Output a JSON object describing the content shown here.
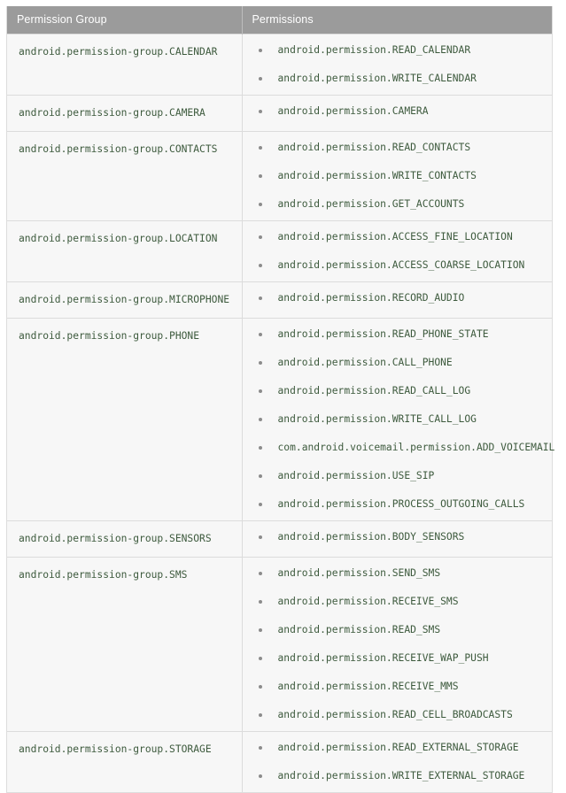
{
  "table": {
    "columns": [
      {
        "key": "group",
        "label": "Permission Group"
      },
      {
        "key": "permissions",
        "label": "Permissions"
      }
    ],
    "colors": {
      "header_bg": "#9b9b9b",
      "header_text": "#ffffff",
      "cell_bg": "#f7f7f7",
      "cell_text": "#3d5a3d",
      "border": "#dcdcdc",
      "bullet": "#8c8c8c"
    },
    "rows": [
      {
        "group": "android.permission-group.CALENDAR",
        "permissions": [
          "android.permission.READ_CALENDAR",
          "android.permission.WRITE_CALENDAR"
        ]
      },
      {
        "group": "android.permission-group.CAMERA",
        "permissions": [
          "android.permission.CAMERA"
        ]
      },
      {
        "group": "android.permission-group.CONTACTS",
        "permissions": [
          "android.permission.READ_CONTACTS",
          "android.permission.WRITE_CONTACTS",
          "android.permission.GET_ACCOUNTS"
        ]
      },
      {
        "group": "android.permission-group.LOCATION",
        "permissions": [
          "android.permission.ACCESS_FINE_LOCATION",
          "android.permission.ACCESS_COARSE_LOCATION"
        ]
      },
      {
        "group": "android.permission-group.MICROPHONE",
        "permissions": [
          "android.permission.RECORD_AUDIO"
        ]
      },
      {
        "group": "android.permission-group.PHONE",
        "permissions": [
          "android.permission.READ_PHONE_STATE",
          "android.permission.CALL_PHONE",
          "android.permission.READ_CALL_LOG",
          "android.permission.WRITE_CALL_LOG",
          "com.android.voicemail.permission.ADD_VOICEMAIL",
          "android.permission.USE_SIP",
          "android.permission.PROCESS_OUTGOING_CALLS"
        ]
      },
      {
        "group": "android.permission-group.SENSORS",
        "permissions": [
          "android.permission.BODY_SENSORS"
        ]
      },
      {
        "group": "android.permission-group.SMS",
        "permissions": [
          "android.permission.SEND_SMS",
          "android.permission.RECEIVE_SMS",
          "android.permission.READ_SMS",
          "android.permission.RECEIVE_WAP_PUSH",
          "android.permission.RECEIVE_MMS",
          "android.permission.READ_CELL_BROADCASTS"
        ]
      },
      {
        "group": "android.permission-group.STORAGE",
        "permissions": [
          "android.permission.READ_EXTERNAL_STORAGE",
          "android.permission.WRITE_EXTERNAL_STORAGE"
        ]
      }
    ]
  }
}
